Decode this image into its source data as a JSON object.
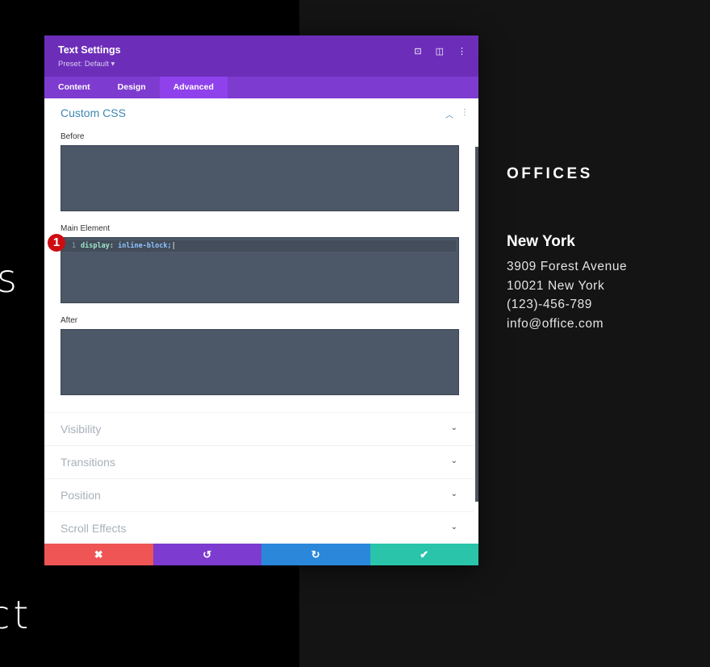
{
  "background": {
    "left_fragment_1": "s",
    "left_fragment_2": "ct"
  },
  "offices": {
    "heading": "OFFICES",
    "city": "New York",
    "lines": [
      "3909 Forest Avenue",
      "10021 New York",
      "(123)-456-789",
      "info@office.com"
    ]
  },
  "modal": {
    "title": "Text Settings",
    "preset": "Preset: Default ▾",
    "header_icons": [
      "focus-icon",
      "split-view-icon",
      "more-icon"
    ],
    "tabs": [
      {
        "label": "Content"
      },
      {
        "label": "Design"
      },
      {
        "label": "Advanced"
      }
    ],
    "active_tab": "Advanced",
    "section": {
      "title": "Custom CSS",
      "fields": [
        {
          "label": "Before",
          "value": ""
        },
        {
          "label": "Main Element",
          "line_number": "1",
          "property": "display:",
          "value": " inline-block;"
        },
        {
          "label": "After",
          "value": ""
        }
      ]
    },
    "badge": "1",
    "collapsed": [
      {
        "label": "Visibility"
      },
      {
        "label": "Transitions"
      },
      {
        "label": "Position"
      },
      {
        "label": "Scroll Effects"
      }
    ],
    "footer": {
      "cancel": "✖",
      "undo": "↺",
      "redo": "↻",
      "save": "✔"
    },
    "colors": {
      "header": "#6c2eb9",
      "tabs": "#7e3bd0",
      "cancel": "#ef5555",
      "undo": "#7d3bcf",
      "redo": "#2b87da",
      "save": "#29c4a9"
    }
  }
}
